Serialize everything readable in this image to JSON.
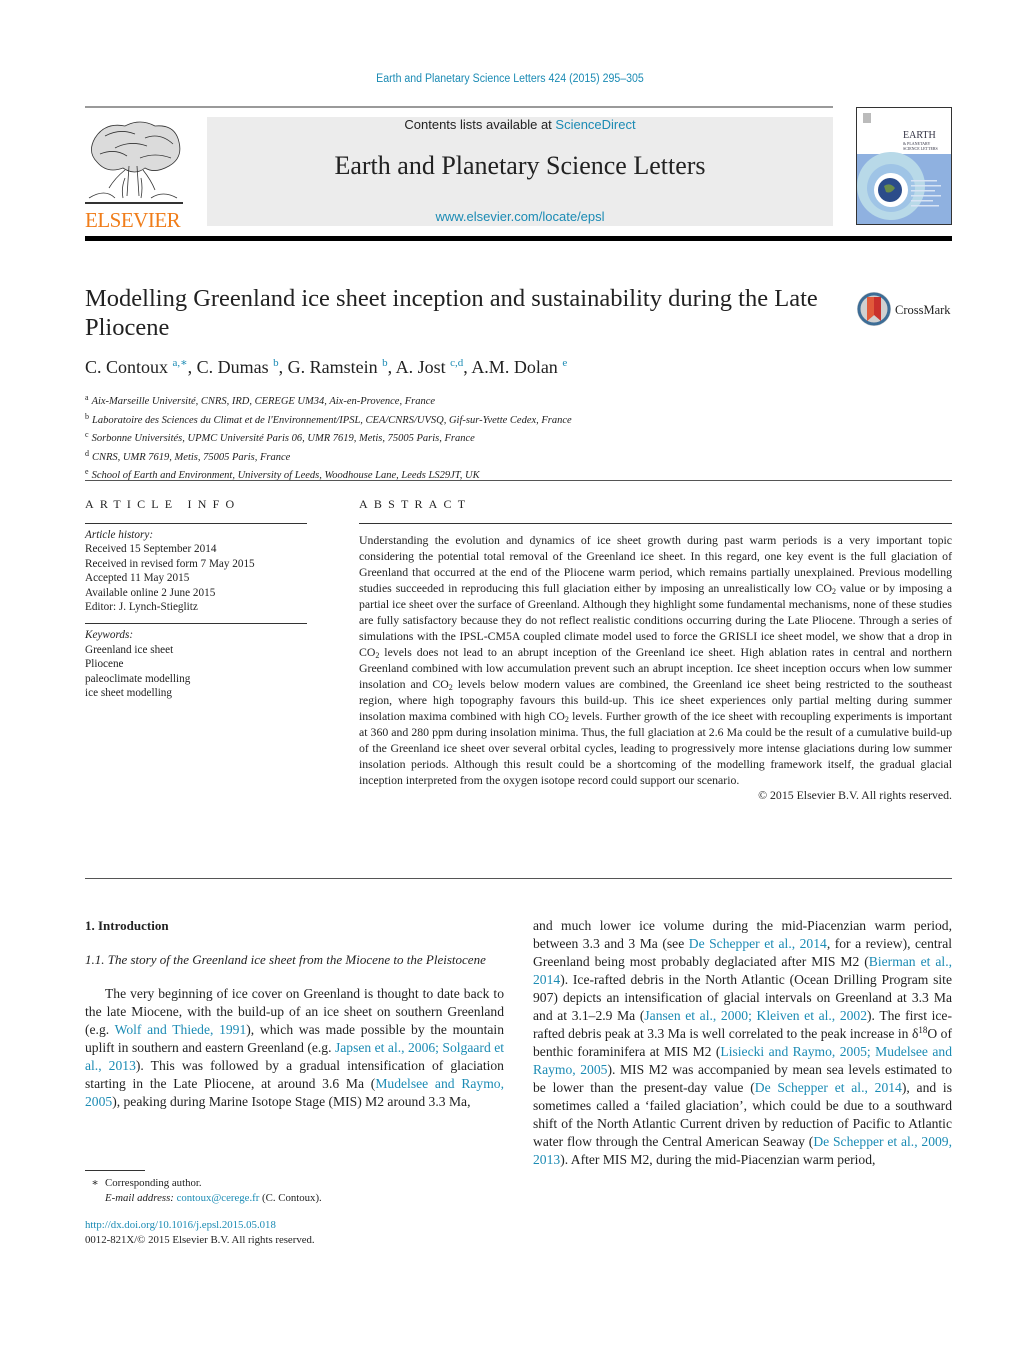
{
  "header": {
    "journal_reference": "Earth and Planetary Science Letters 424 (2015) 295–305",
    "contents_prefix": "Contents lists available at ",
    "contents_link": "ScienceDirect",
    "journal_title": "Earth and Planetary Science Letters",
    "journal_url": "www.elsevier.com/locate/epsl",
    "publisher_logo_text": "ELSEVIER",
    "cover_title": "EARTH",
    "cover_subtitle": "& PLANETARY SCIENCE LETTERS",
    "publisher_color": "#f07d1a",
    "link_color": "#1b8bb4"
  },
  "article": {
    "title": "Modelling Greenland ice sheet inception and sustainability during the Late Pliocene",
    "crossmark_label": "CrossMark",
    "authors": [
      {
        "name": "C. Contoux",
        "marks": "a,∗"
      },
      {
        "name": "C. Dumas",
        "marks": "b"
      },
      {
        "name": "G. Ramstein",
        "marks": "b"
      },
      {
        "name": "A. Jost",
        "marks": "c,d"
      },
      {
        "name": "A.M. Dolan",
        "marks": "e"
      }
    ],
    "affiliations": [
      {
        "mark": "a",
        "text": "Aix-Marseille Université, CNRS, IRD, CEREGE UM34, Aix-en-Provence, France"
      },
      {
        "mark": "b",
        "text": "Laboratoire des Sciences du Climat et de l'Environnement/IPSL, CEA/CNRS/UVSQ, Gif-sur-Yvette Cedex, France"
      },
      {
        "mark": "c",
        "text": "Sorbonne Universités, UPMC Université Paris 06, UMR 7619, Metis, 75005 Paris, France"
      },
      {
        "mark": "d",
        "text": "CNRS, UMR 7619, Metis, 75005 Paris, France"
      },
      {
        "mark": "e",
        "text": "School of Earth and Environment, University of Leeds, Woodhouse Lane, Leeds LS29JT, UK"
      }
    ]
  },
  "article_info": {
    "heading": "ARTICLE INFO",
    "history_label": "Article history:",
    "history": [
      "Received 15 September 2014",
      "Received in revised form 7 May 2015",
      "Accepted 11 May 2015",
      "Available online 2 June 2015",
      "Editor: J. Lynch-Stieglitz"
    ],
    "keywords_label": "Keywords:",
    "keywords": [
      "Greenland ice sheet",
      "Pliocene",
      "paleoclimate modelling",
      "ice sheet modelling"
    ]
  },
  "abstract": {
    "heading": "ABSTRACT",
    "parts": [
      "Understanding the evolution and dynamics of ice sheet growth during past warm periods is a very important topic considering the potential total removal of the Greenland ice sheet. In this regard, one key event is the full glaciation of Greenland that occurred at the end of the Pliocene warm period, which remains partially unexplained. Previous modelling studies succeeded in reproducing this full glaciation either by imposing an unrealistically low CO",
      " value or by imposing a partial ice sheet over the surface of Greenland. Although they highlight some fundamental mechanisms, none of these studies are fully satisfactory because they do not reflect realistic conditions occurring during the Late Pliocene. Through a series of simulations with the IPSL-CM5A coupled climate model used to force the GRISLI ice sheet model, we show that a drop in CO",
      " levels does not lead to an abrupt inception of the Greenland ice sheet. High ablation rates in central and northern Greenland combined with low accumulation prevent such an abrupt inception. Ice sheet inception occurs when low summer insolation and CO",
      " levels below modern values are combined, the Greenland ice sheet being restricted to the southeast region, where high topography favours this build-up. This ice sheet experiences only partial melting during summer insolation maxima combined with high CO",
      " levels. Further growth of the ice sheet with recoupling experiments is important at 360 and 280 ppm during insolation minima. Thus, the full glaciation at 2.6 Ma could be the result of a cumulative build-up of the Greenland ice sheet over several orbital cycles, leading to progressively more intense glaciations during low summer insolation periods. Although this result could be a shortcoming of the modelling framework itself, the gradual glacial inception interpreted from the oxygen isotope record could support our scenario."
    ],
    "subscript": "2",
    "copyright": "© 2015 Elsevier B.V. All rights reserved."
  },
  "body": {
    "section_heading": "1. Introduction",
    "subsection_heading": "1.1. The story of the Greenland ice sheet from the Miocene to the Pleistocene",
    "left": [
      {
        "t": "The very beginning of ice cover on Greenland is thought to date back to the late Miocene, with the build-up of an ice sheet on southern Greenland (e.g. "
      },
      {
        "t": "Wolf and Thiede, 1991",
        "link": true
      },
      {
        "t": "), which was made possible by the mountain uplift in southern and eastern Greenland (e.g. "
      },
      {
        "t": "Japsen et al., 2006; Solgaard et al., 2013",
        "link": true
      },
      {
        "t": "). This was followed by a gradual intensification of glaciation starting in the Late Pliocene, at around 3.6 Ma ("
      },
      {
        "t": "Mudelsee and Raymo, 2005",
        "link": true
      },
      {
        "t": "), peaking during Marine Isotope Stage (MIS) M2 around 3.3 Ma,"
      }
    ],
    "right": [
      {
        "t": "and much lower ice volume during the mid-Piacenzian warm period, between 3.3 and 3 Ma (see "
      },
      {
        "t": "De Schepper et al., 2014",
        "link": true
      },
      {
        "t": ", for a review), central Greenland being most probably deglaciated after MIS M2 ("
      },
      {
        "t": "Bierman et al., 2014",
        "link": true
      },
      {
        "t": "). Ice-rafted debris in the North Atlantic (Ocean Drilling Program site 907) depicts an intensification of glacial intervals on Greenland at 3.3 Ma and at 3.1–2.9 Ma ("
      },
      {
        "t": "Jansen et al., 2000; Kleiven et al., 2002",
        "link": true
      },
      {
        "t": "). The first ice-rafted debris peak at 3.3 Ma is well correlated to the peak increase in δ"
      },
      {
        "t": "18",
        "sup": true
      },
      {
        "t": "O of benthic foraminifera at MIS M2 ("
      },
      {
        "t": "Lisiecki and Raymo, 2005; Mudelsee and Raymo, 2005",
        "link": true
      },
      {
        "t": "). MIS M2 was accompanied by mean sea levels estimated to be lower than the present-day value ("
      },
      {
        "t": "De Schepper et al., 2014",
        "link": true
      },
      {
        "t": "), and is sometimes called a ‘failed glaciation’, which could be due to a southward shift of the North Atlantic Current driven by reduction of Pacific to Atlantic water flow through the Central American Seaway ("
      },
      {
        "t": "De Schepper et al., 2009, 2013",
        "link": true
      },
      {
        "t": "). After MIS M2, during the mid-Piacenzian warm period,"
      }
    ]
  },
  "footnote": {
    "marker": "∗",
    "corresponding": "Corresponding author.",
    "email_label": "E-mail address: ",
    "email": "contoux@cerege.fr",
    "email_suffix": " (C. Contoux).",
    "doi": "http://dx.doi.org/10.1016/j.epsl.2015.05.018",
    "issn_line": "0012-821X/© 2015 Elsevier B.V. All rights reserved."
  }
}
